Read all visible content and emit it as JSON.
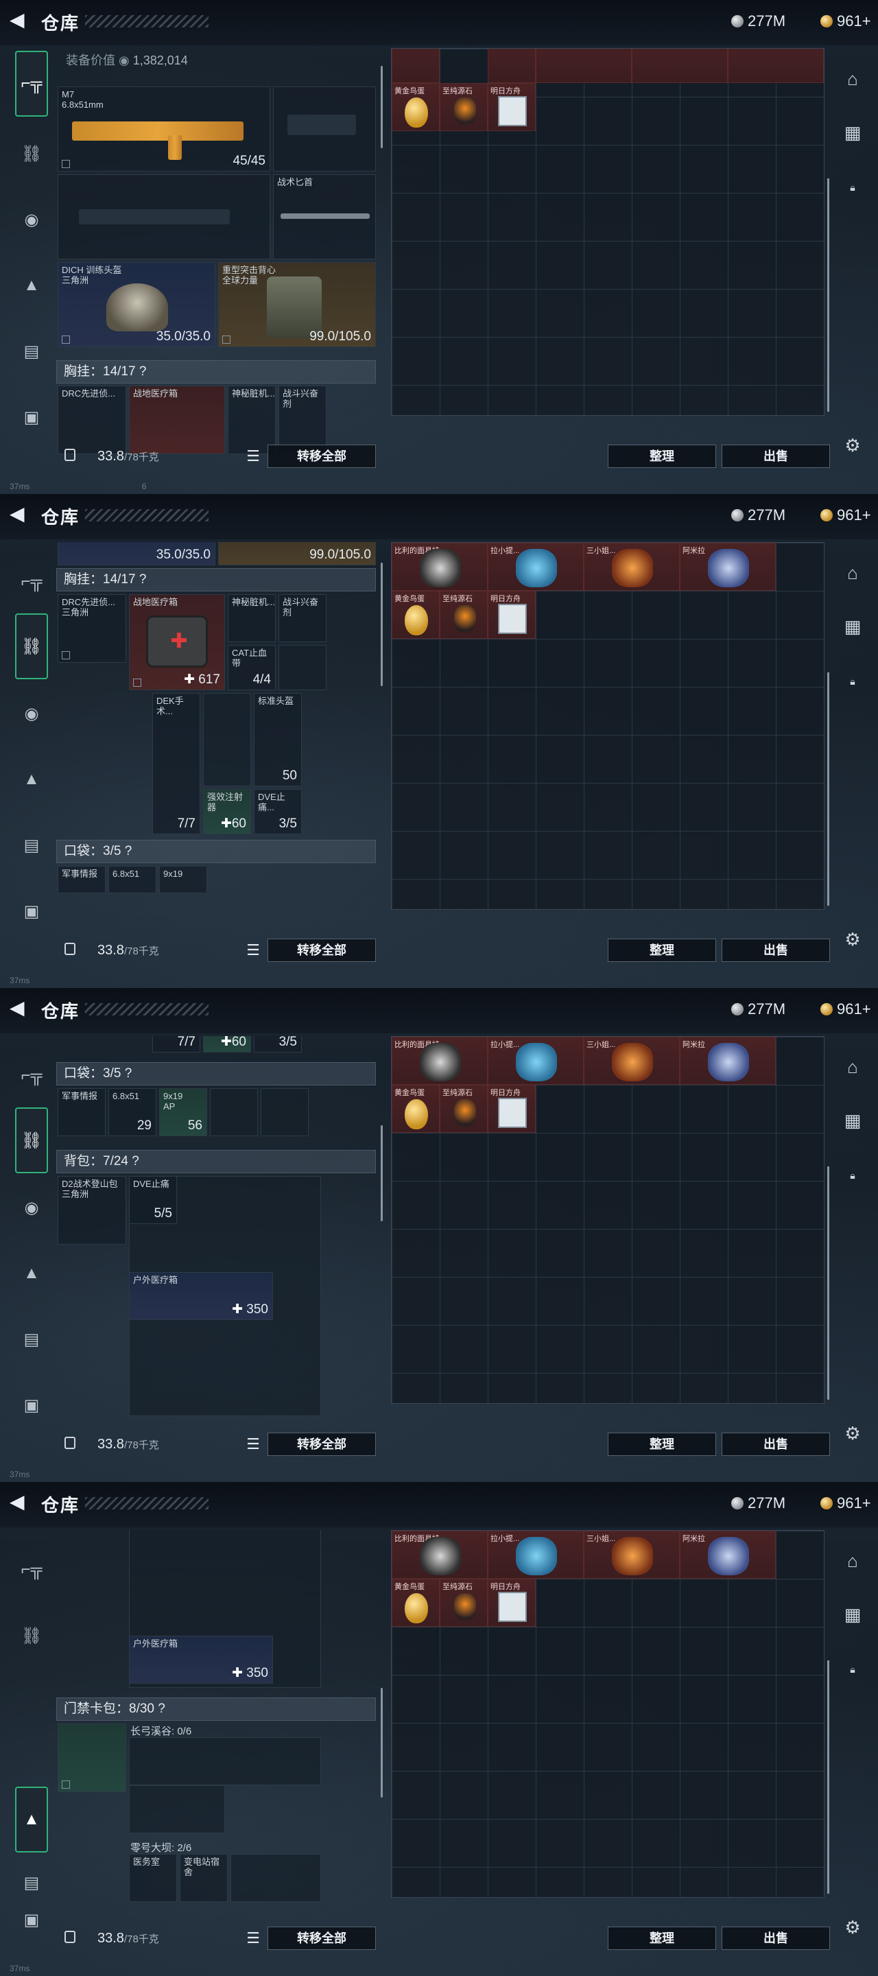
{
  "header": {
    "title": "仓库",
    "silver": "277M",
    "gold": "961+"
  },
  "loadout": {
    "value_label": "装备价值",
    "value": "1,382,014",
    "primary": {
      "name": "M7",
      "caliber": "6.8x51mm",
      "ammo": "45/45"
    },
    "knife": {
      "name": "战术匕首"
    },
    "helmet": {
      "name": "DICH 训练头盔",
      "sub": "三角洲",
      "dur": "35.0/35.0"
    },
    "armor": {
      "name": "重型突击背心",
      "sub": "全球力量",
      "dur": "99.0/105.0"
    },
    "chest": {
      "header": "胸挂：14/17",
      "help": "?"
    },
    "chest_items": {
      "rig": "DRC先进侦...",
      "rig_sub": "三角洲",
      "medkit": "战地医疗箱",
      "medkit_qty": "617",
      "relic": "神秘脏机...",
      "stim": "战斗兴奋剂",
      "tourniquet": "CAT止血带",
      "tourniquet_qty": "4/4",
      "dek": "DEK手术...",
      "dek_qty": "7/7",
      "head": "标准头盔",
      "head_qty": "50",
      "strong": "强效注射器",
      "strong_qty": "60",
      "dve": "DVE止痛...",
      "dve_qty": "3/5"
    },
    "pocket": {
      "header": "口袋：3/5",
      "help": "?"
    },
    "pocket_items": {
      "intel": "军事情报",
      "ammo1": "6.8x51",
      "ammo1_qty": "29",
      "ammo2": "9x19",
      "ammo2_sub": "AP",
      "ammo2_qty": "56"
    },
    "backpack": {
      "header": "背包：7/24",
      "help": "?"
    },
    "backpack_items": {
      "pack": "D2战术登山包",
      "pack_sub": "三角洲",
      "dve": "DVE止痛",
      "dve_qty": "5/5",
      "outdoor": "户外医疗箱",
      "outdoor_qty": "350"
    },
    "keycase": {
      "header": "门禁卡包：8/30",
      "help": "?"
    },
    "keycase_items": {
      "longbow": "长弓溪谷: 0/6",
      "dam": "零号大坝: 2/6",
      "medical": "医务室",
      "substation": "变电站宿舍"
    }
  },
  "bottom": {
    "weight": "33.8",
    "weight_unit": "/78千克",
    "transfer": "转移全部",
    "sort": "整理",
    "sell": "出售"
  },
  "stash_labels": {
    "a": "比利的面具娃",
    "b": "拉小提...",
    "c": "三小姐...",
    "d": "阿米拉",
    "egg": "黄金鸟蛋",
    "stone": "至纯源石",
    "tomorrow": "明日方舟"
  },
  "status": {
    "ping": "37ms",
    "num": "6"
  }
}
